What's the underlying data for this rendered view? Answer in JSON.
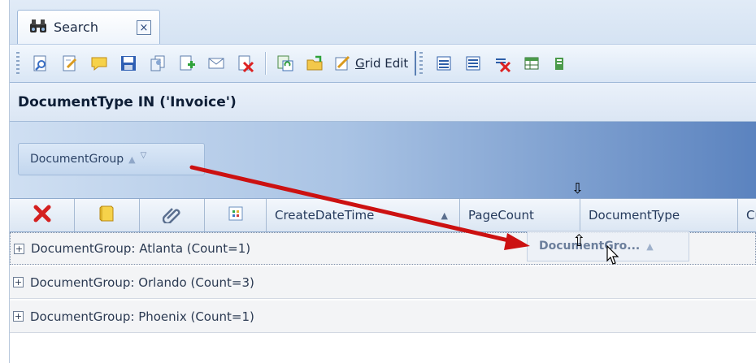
{
  "tab": {
    "label": "Search",
    "close": "×"
  },
  "toolbar": {
    "grid_edit_label_underlined": "G",
    "grid_edit_label_rest": "rid Edit"
  },
  "filter": {
    "text": "DocumentType IN ('Invoice')"
  },
  "group_panel": {
    "chip_label": "DocumentGroup"
  },
  "columns": [
    {
      "label": "",
      "icon": "delete-icon"
    },
    {
      "label": "",
      "icon": "note-icon"
    },
    {
      "label": "",
      "icon": "attachment-icon"
    },
    {
      "label": "",
      "icon": "status-icon"
    },
    {
      "label": "CreateDateTime",
      "sorted": "asc"
    },
    {
      "label": "PageCount"
    },
    {
      "label": "DocumentType"
    },
    {
      "label": "Cu"
    }
  ],
  "groups": [
    {
      "label": "DocumentGroup: Atlanta (Count=1)"
    },
    {
      "label": "DocumentGroup: Orlando (Count=3)"
    },
    {
      "label": "DocumentGroup: Phoenix (Count=1)"
    }
  ],
  "drag": {
    "label": "DocumentGro..."
  },
  "colors": {
    "accent": "#5b83bf",
    "arrow": "#cc1111"
  }
}
